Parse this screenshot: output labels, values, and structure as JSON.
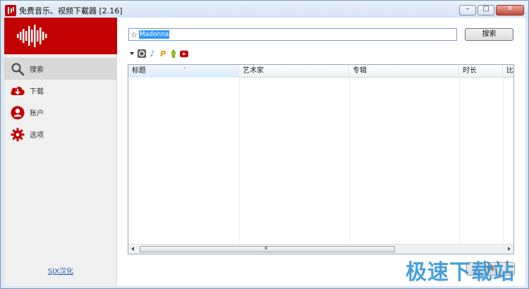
{
  "window": {
    "title": "免费音乐、视频下載器 [2.16]",
    "minimize_glyph": "–",
    "maximize_glyph": "□",
    "close_glyph": "✕"
  },
  "sidebar": {
    "items": [
      {
        "label": "搜索",
        "icon": "search-icon"
      },
      {
        "label": "下载",
        "icon": "download-cloud-icon"
      },
      {
        "label": "账户",
        "icon": "user-icon"
      },
      {
        "label": "选项",
        "icon": "gear-icon"
      }
    ],
    "credit": "SJX汉化"
  },
  "search": {
    "star": "☆",
    "value": "Madonna",
    "button_label": "搜索"
  },
  "sources": {
    "icons": [
      "dropdown-icon",
      "grooveshark-icon",
      "music-note-icon",
      "pandora-icon",
      "soundcloud-icon",
      "youtube-icon"
    ],
    "p_glyph": "P",
    "note_glyph": "♪"
  },
  "table": {
    "columns": [
      "标题",
      "艺术家",
      "专辑",
      "时长",
      "比"
    ],
    "sort_indicator": "ˆ",
    "rows": [],
    "scroll_grip": "III"
  },
  "footer": {
    "ok_label": "确"
  },
  "watermark": "极速下载站",
  "colors": {
    "brand_red": "#c30000",
    "icon_red": "#c40000",
    "accent_blue": "#3399ff"
  }
}
